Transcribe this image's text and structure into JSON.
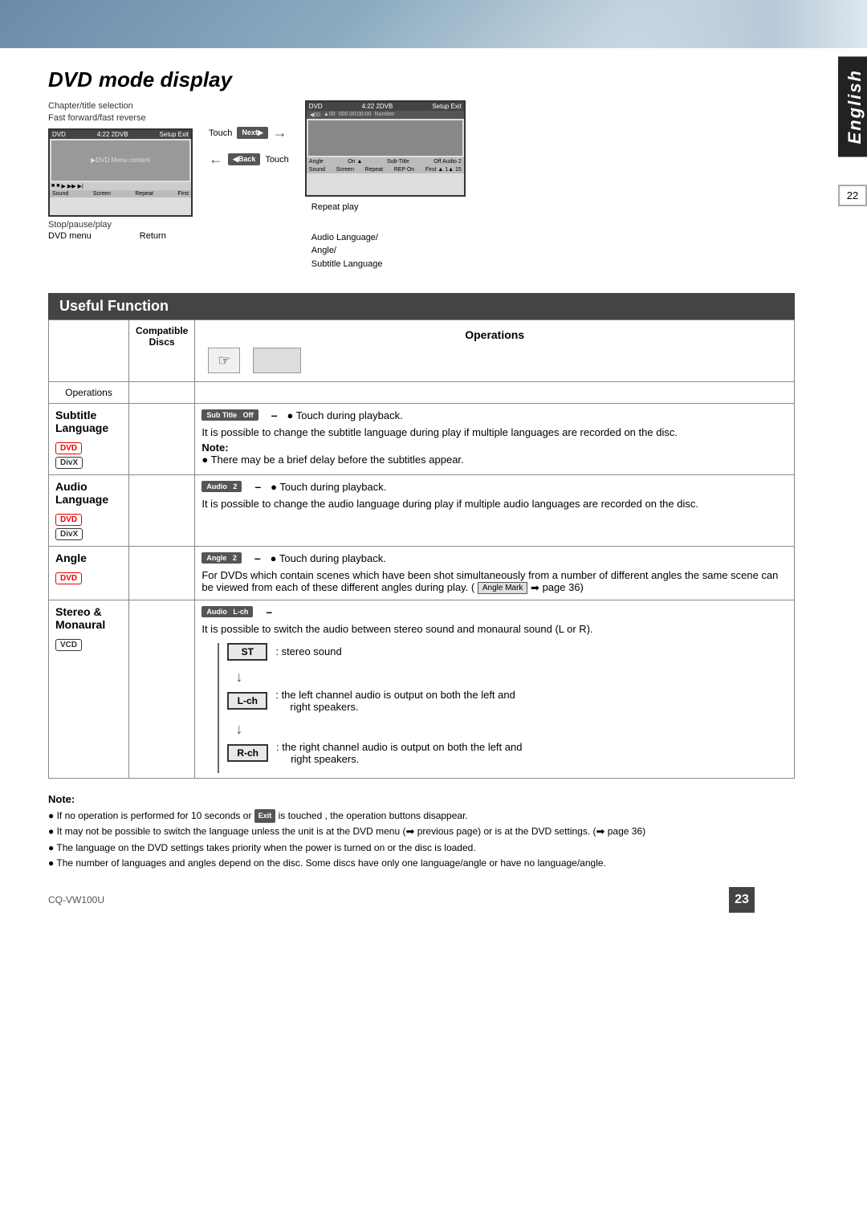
{
  "topBanner": {
    "alt": "Mountain landscape banner"
  },
  "englishTab": {
    "text": "English"
  },
  "pageNumber": "22",
  "dvdSection": {
    "title": "DVD",
    "subtitle": "mode display",
    "labels": {
      "chapterTitle": "Chapter/title selection",
      "fastForward": "Fast forward/fast reverse",
      "stopPause": "Stop/pause/play",
      "dvdMenu": "DVD menu",
      "returnLabel": "Return",
      "repeatPlay": "Repeat play",
      "audioAngleSubtitle": "Audio Language/\nAngle/\nSubtitle Language",
      "touchNext": "Touch",
      "touchNextBtn": "Next▶",
      "touchBack": "Touch",
      "touchBackBtn": "◀Back"
    }
  },
  "usefulFunction": {
    "title": "Useful Function",
    "operationsHeader": "Operations",
    "operationsLabel": "Operations",
    "compatibleDiscs": "Compatible\nDiscs",
    "rows": [
      {
        "label": "Subtitle Language",
        "discs": [
          "DVD",
          "DivX"
        ],
        "button": "Sub Title  Off",
        "dash": "–",
        "touchNote": "Touch during playback.",
        "description": "It is possible to change the subtitle language during play if multiple languages are recorded on the disc.",
        "note": "Note:",
        "noteItems": [
          "There may be a brief delay before the subtitles appear."
        ]
      },
      {
        "label": "Audio Language",
        "discs": [
          "DVD",
          "DivX"
        ],
        "button": "Audio  2",
        "dash": "–",
        "touchNote": "Touch during playback.",
        "description": "It is possible to change the audio language during play if multiple audio languages are recorded on the disc.",
        "note": "",
        "noteItems": []
      },
      {
        "label": "Angle",
        "discs": [
          "DVD"
        ],
        "button": "Angle  2",
        "dash": "–",
        "touchNote": "Touch during playback.",
        "description": "For DVDs which contain scenes which have been shot simultaneously from a number of different angles the same scene can be viewed from each of these different angles during play. (  Angle Mark  ➡ page 36)",
        "note": "",
        "noteItems": []
      },
      {
        "label": "Stereo & Monaural",
        "discs": [
          "VCD"
        ],
        "button": "Audio  L-ch",
        "dash": "–",
        "touchNote": "",
        "description": "It is possible to switch the audio between stereo sound and monaural sound (L or R).",
        "note": "",
        "noteItems": [],
        "stereoRows": [
          {
            "label": "ST",
            "description": ": stereo sound"
          },
          {
            "label": "L-ch",
            "description": ": the left channel audio is output on both the left and right speakers."
          },
          {
            "label": "R-ch",
            "description": ": the right channel audio is output on both the left and right speakers."
          }
        ]
      }
    ]
  },
  "bottomNote": {
    "title": "Note:",
    "items": [
      "If no operation is performed for 10 seconds or  Exit  is touched , the operation buttons disappear.",
      "It may not be possible to switch the language unless the unit is at the DVD menu (➡ previous page) or is at the DVD settings. (➡ page 36)",
      "The language on the DVD settings takes priority when the power is turned on or the disc is loaded.",
      "The number of languages and angles depend on the disc. Some discs have only one language/angle or have no language/angle."
    ]
  },
  "footer": {
    "model": "CQ-VW100U",
    "pageNumber": "23"
  }
}
